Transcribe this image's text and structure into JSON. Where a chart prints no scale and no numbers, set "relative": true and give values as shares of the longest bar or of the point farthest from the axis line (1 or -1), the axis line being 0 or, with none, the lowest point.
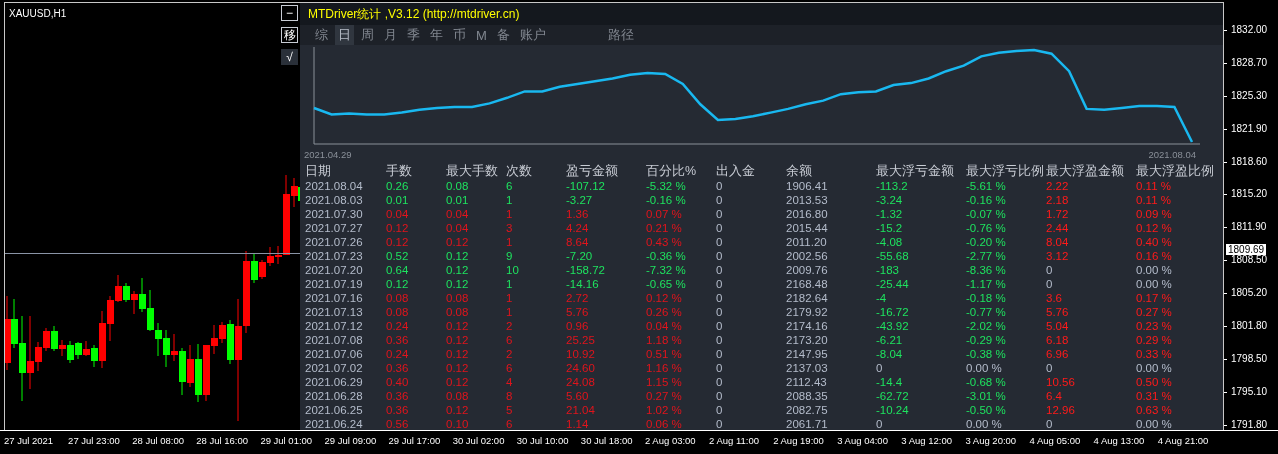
{
  "symbol": "XAUUSD,H1",
  "side_buttons": [
    "−",
    "移",
    "√"
  ],
  "panel": {
    "title": "MTDriver统计 ,V3.12 (http://mtdriver.cn)",
    "tabs": [
      {
        "label": "综",
        "selected": false
      },
      {
        "label": "日",
        "selected": true
      },
      {
        "label": "周",
        "selected": false
      },
      {
        "label": "月",
        "selected": false
      },
      {
        "label": "季",
        "selected": false
      },
      {
        "label": "年",
        "selected": false
      },
      {
        "label": "币",
        "selected": false
      },
      {
        "label": "M",
        "selected": false
      },
      {
        "label": "备",
        "selected": false
      },
      {
        "label": "账户",
        "selected": false
      }
    ],
    "path_button": "路径",
    "equity_chart": {
      "start_label": "2021.04.29",
      "end_label": "2021.08.04",
      "chart_data": {
        "type": "line",
        "relative": true,
        "series": [
          {
            "color": "#19b8f0",
            "values": [
              0.37,
              0.3,
              0.31,
              0.3,
              0.3,
              0.32,
              0.35,
              0.37,
              0.38,
              0.38,
              0.42,
              0.48,
              0.55,
              0.55,
              0.6,
              0.63,
              0.66,
              0.69,
              0.73,
              0.75,
              0.74,
              0.63,
              0.41,
              0.24,
              0.25,
              0.28,
              0.32,
              0.36,
              0.41,
              0.45,
              0.52,
              0.54,
              0.55,
              0.62,
              0.64,
              0.69,
              0.77,
              0.83,
              0.93,
              0.97,
              0.99,
              1,
              0.96,
              0.77,
              0.36,
              0.35,
              0.37,
              0.39,
              0.39,
              0.38,
              0
            ]
          }
        ]
      }
    },
    "table": {
      "columns": [
        "日期",
        "手数",
        "最大手数",
        "次数",
        "盈亏金额",
        "百分比%",
        "出入金",
        "余额",
        "最大浮亏金额",
        "最大浮亏比例",
        "最大浮盈金额",
        "最大浮盈比例"
      ],
      "rows": [
        {
          "cells": [
            "2021.08.04",
            "0.26",
            "0.08",
            "6",
            "-107.12",
            "-5.32 %",
            "0",
            "1906.41",
            "-113.2",
            "-5.61 %",
            "2.22",
            "0.11 %"
          ],
          "losing_day": true,
          "float_loss_zero": false,
          "float_profit_zero": false
        },
        {
          "cells": [
            "2021.08.03",
            "0.01",
            "0.01",
            "1",
            "-3.27",
            "-0.16 %",
            "0",
            "2013.53",
            "-3.24",
            "-0.16 %",
            "2.18",
            "0.11 %"
          ],
          "losing_day": true,
          "float_loss_zero": false,
          "float_profit_zero": false
        },
        {
          "cells": [
            "2021.07.30",
            "0.04",
            "0.04",
            "1",
            "1.36",
            "0.07 %",
            "0",
            "2016.80",
            "-1.32",
            "-0.07 %",
            "1.72",
            "0.09 %"
          ],
          "losing_day": false,
          "float_loss_zero": false,
          "float_profit_zero": false
        },
        {
          "cells": [
            "2021.07.27",
            "0.12",
            "0.04",
            "3",
            "4.24",
            "0.21 %",
            "0",
            "2015.44",
            "-15.2",
            "-0.76 %",
            "2.44",
            "0.12 %"
          ],
          "losing_day": false,
          "float_loss_zero": false,
          "float_profit_zero": false
        },
        {
          "cells": [
            "2021.07.26",
            "0.12",
            "0.12",
            "1",
            "8.64",
            "0.43 %",
            "0",
            "2011.20",
            "-4.08",
            "-0.20 %",
            "8.04",
            "0.40 %"
          ],
          "losing_day": false,
          "float_loss_zero": false,
          "float_profit_zero": false
        },
        {
          "cells": [
            "2021.07.23",
            "0.52",
            "0.12",
            "9",
            "-7.20",
            "-0.36 %",
            "0",
            "2002.56",
            "-55.68",
            "-2.77 %",
            "3.12",
            "0.16 %"
          ],
          "losing_day": true,
          "float_loss_zero": false,
          "float_profit_zero": false
        },
        {
          "cells": [
            "2021.07.20",
            "0.64",
            "0.12",
            "10",
            "-158.72",
            "-7.32 %",
            "0",
            "2009.76",
            "-183",
            "-8.36 %",
            "0",
            "0.00 %"
          ],
          "losing_day": true,
          "float_loss_zero": false,
          "float_profit_zero": true
        },
        {
          "cells": [
            "2021.07.19",
            "0.12",
            "0.12",
            "1",
            "-14.16",
            "-0.65 %",
            "0",
            "2168.48",
            "-25.44",
            "-1.17 %",
            "0",
            "0.00 %"
          ],
          "losing_day": true,
          "float_loss_zero": false,
          "float_profit_zero": true
        },
        {
          "cells": [
            "2021.07.16",
            "0.08",
            "0.08",
            "1",
            "2.72",
            "0.12 %",
            "0",
            "2182.64",
            "-4",
            "-0.18 %",
            "3.6",
            "0.17 %"
          ],
          "losing_day": false,
          "float_loss_zero": false,
          "float_profit_zero": false
        },
        {
          "cells": [
            "2021.07.13",
            "0.08",
            "0.08",
            "1",
            "5.76",
            "0.26 %",
            "0",
            "2179.92",
            "-16.72",
            "-0.77 %",
            "5.76",
            "0.27 %"
          ],
          "losing_day": false,
          "float_loss_zero": false,
          "float_profit_zero": false
        },
        {
          "cells": [
            "2021.07.12",
            "0.24",
            "0.12",
            "2",
            "0.96",
            "0.04 %",
            "0",
            "2174.16",
            "-43.92",
            "-2.02 %",
            "5.04",
            "0.23 %"
          ],
          "losing_day": false,
          "float_loss_zero": false,
          "float_profit_zero": false
        },
        {
          "cells": [
            "2021.07.08",
            "0.36",
            "0.12",
            "6",
            "25.25",
            "1.18 %",
            "0",
            "2173.20",
            "-6.21",
            "-0.29 %",
            "6.18",
            "0.29 %"
          ],
          "losing_day": false,
          "float_loss_zero": false,
          "float_profit_zero": false
        },
        {
          "cells": [
            "2021.07.06",
            "0.24",
            "0.12",
            "2",
            "10.92",
            "0.51 %",
            "0",
            "2147.95",
            "-8.04",
            "-0.38 %",
            "6.96",
            "0.33 %"
          ],
          "losing_day": false,
          "float_loss_zero": false,
          "float_profit_zero": false
        },
        {
          "cells": [
            "2021.07.02",
            "0.36",
            "0.12",
            "6",
            "24.60",
            "1.16 %",
            "0",
            "2137.03",
            "0",
            "0.00 %",
            "0",
            "0.00 %"
          ],
          "losing_day": false,
          "float_loss_zero": true,
          "float_profit_zero": true
        },
        {
          "cells": [
            "2021.06.29",
            "0.40",
            "0.12",
            "4",
            "24.08",
            "1.15 %",
            "0",
            "2112.43",
            "-14.4",
            "-0.68 %",
            "10.56",
            "0.50 %"
          ],
          "losing_day": false,
          "float_loss_zero": false,
          "float_profit_zero": false
        },
        {
          "cells": [
            "2021.06.28",
            "0.36",
            "0.08",
            "8",
            "5.60",
            "0.27 %",
            "0",
            "2088.35",
            "-62.72",
            "-3.01 %",
            "6.4",
            "0.31 %"
          ],
          "losing_day": false,
          "float_loss_zero": false,
          "float_profit_zero": false
        },
        {
          "cells": [
            "2021.06.25",
            "0.36",
            "0.12",
            "5",
            "21.04",
            "1.02 %",
            "0",
            "2082.75",
            "-10.24",
            "-0.50 %",
            "12.96",
            "0.63 %"
          ],
          "losing_day": false,
          "float_loss_zero": false,
          "float_profit_zero": false
        },
        {
          "cells": [
            "2021.06.24",
            "0.56",
            "0.10",
            "6",
            "1.14",
            "0.06 %",
            "0",
            "2061.71",
            "0",
            "0.00 %",
            "0",
            "0.00 %"
          ],
          "losing_day": false,
          "float_loss_zero": true,
          "float_profit_zero": true
        }
      ]
    }
  },
  "price_axis": {
    "labels": [
      "1832.00",
      "1828.70",
      "1825.30",
      "1821.90",
      "1818.60",
      "1815.20",
      "1811.90",
      "1808.50",
      "1805.20",
      "1801.80",
      "1798.50",
      "1795.10",
      "1791.80"
    ],
    "current_price": "1809.69"
  },
  "time_axis": {
    "labels": [
      "27 Jul 2021",
      "27 Jul 23:00",
      "28 Jul 08:00",
      "28 Jul 16:00",
      "29 Jul 01:00",
      "29 Jul 09:00",
      "29 Jul 17:00",
      "30 Jul 02:00",
      "30 Jul 10:00",
      "30 Jul 18:00",
      "2 Aug 03:00",
      "2 Aug 11:00",
      "2 Aug 19:00",
      "3 Aug 04:00",
      "3 Aug 12:00",
      "3 Aug 20:00",
      "4 Aug 05:00",
      "4 Aug 13:00",
      "4 Aug 21:00"
    ]
  }
}
